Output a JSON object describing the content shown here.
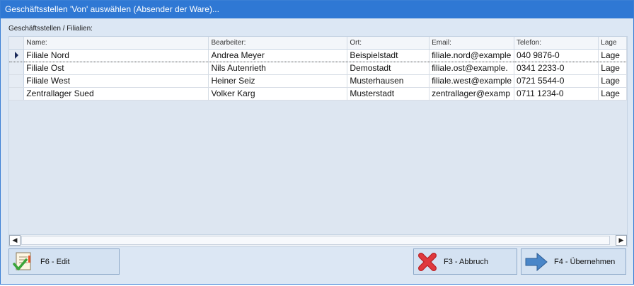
{
  "window": {
    "title": "Geschäftsstellen 'Von' auswählen (Absender der Ware)..."
  },
  "grid": {
    "caption": "Geschäftsstellen / Filialien:",
    "columns": [
      "Name:",
      "Bearbeiter:",
      "Ort:",
      "Email:",
      "Telefon:",
      "Lage"
    ],
    "rows": [
      [
        "Filiale Nord",
        "Andrea Meyer",
        "Beispielstadt",
        "filiale.nord@example",
        "040 9876-0",
        "Lage"
      ],
      [
        "Filiale Ost",
        "Nils Autenrieth",
        "Demostadt",
        "filiale.ost@example.",
        "0341 2233-0",
        "Lage"
      ],
      [
        "Filiale West",
        "Heiner Seiz",
        "Musterhausen",
        "filiale.west@example",
        "0721 5544-0",
        "Lage"
      ],
      [
        "Zentrallager Sued",
        "Volker Karg",
        "Musterstadt",
        "zentrallager@examp",
        "0711 1234-0",
        "Lage"
      ]
    ],
    "current_row": 0
  },
  "buttons": {
    "edit": "F6 - Edit",
    "abbruch": "F3 - Abbruch",
    "uebernehmen": "F4 - Übernehmen"
  },
  "scrollbar": {
    "left_arrow": "◀",
    "right_arrow": "▶"
  },
  "icons": {
    "edit": "checklist-edit-icon",
    "abbruch": "red-x-icon",
    "uebernehmen": "blue-arrow-right-icon"
  },
  "colors": {
    "titlebar": "#2f78d4",
    "window_bg": "#dce7f4",
    "grid_bg": "#dde6f1",
    "cancel_red": "#e0393d",
    "arrow_blue": "#4a86c8"
  }
}
